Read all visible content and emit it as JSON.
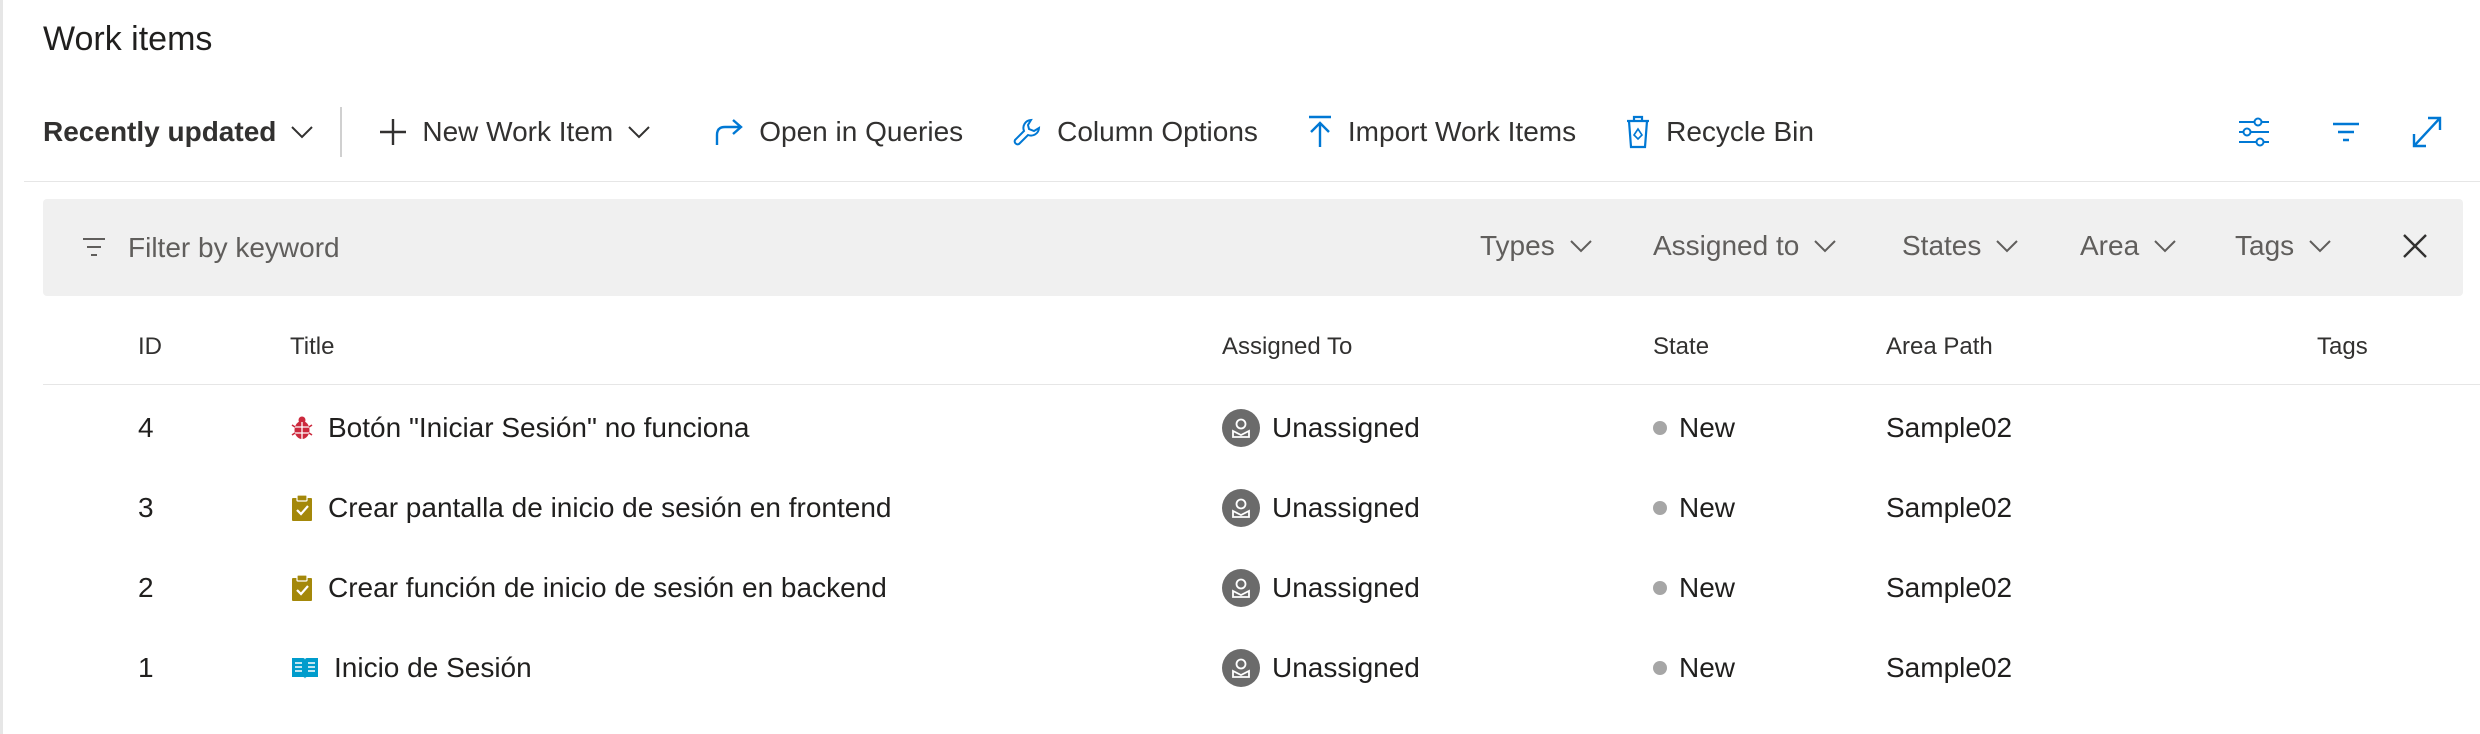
{
  "page": {
    "title": "Work items"
  },
  "toolbar": {
    "view_label": "Recently updated",
    "new_item_label": "New Work Item",
    "open_queries_label": "Open in Queries",
    "column_options_label": "Column Options",
    "import_label": "Import Work Items",
    "recycle_label": "Recycle Bin",
    "right_icons": [
      "view-options-icon",
      "filter-icon",
      "expand-icon"
    ]
  },
  "filter": {
    "keyword_placeholder": "Filter by keyword",
    "dropdowns": [
      "Types",
      "Assigned to",
      "States",
      "Area",
      "Tags"
    ]
  },
  "table": {
    "columns": [
      "ID",
      "Title",
      "Assigned To",
      "State",
      "Area Path",
      "Tags"
    ],
    "rows": [
      {
        "id": "4",
        "type_icon": "bug-icon",
        "title": "Botón \"Iniciar Sesión\" no funciona",
        "assigned": "Unassigned",
        "state": "New",
        "area": "Sample02",
        "tags": ""
      },
      {
        "id": "3",
        "type_icon": "task-icon",
        "title": "Crear pantalla de inicio de sesión en frontend",
        "assigned": "Unassigned",
        "state": "New",
        "area": "Sample02",
        "tags": ""
      },
      {
        "id": "2",
        "type_icon": "task-icon",
        "title": "Crear función de inicio de sesión en backend",
        "assigned": "Unassigned",
        "state": "New",
        "area": "Sample02",
        "tags": ""
      },
      {
        "id": "1",
        "type_icon": "user-story-icon",
        "title": "Inicio de Sesión",
        "assigned": "Unassigned",
        "state": "New",
        "area": "Sample02",
        "tags": ""
      }
    ]
  },
  "colors": {
    "bug": "#cc293d",
    "task": "#a4880a",
    "user_story": "#009ccc",
    "accent": "#0078d4",
    "state_new": "#a6a6a6",
    "avatar": "#6b6b6b",
    "filter_bg": "#f0f0f0"
  }
}
